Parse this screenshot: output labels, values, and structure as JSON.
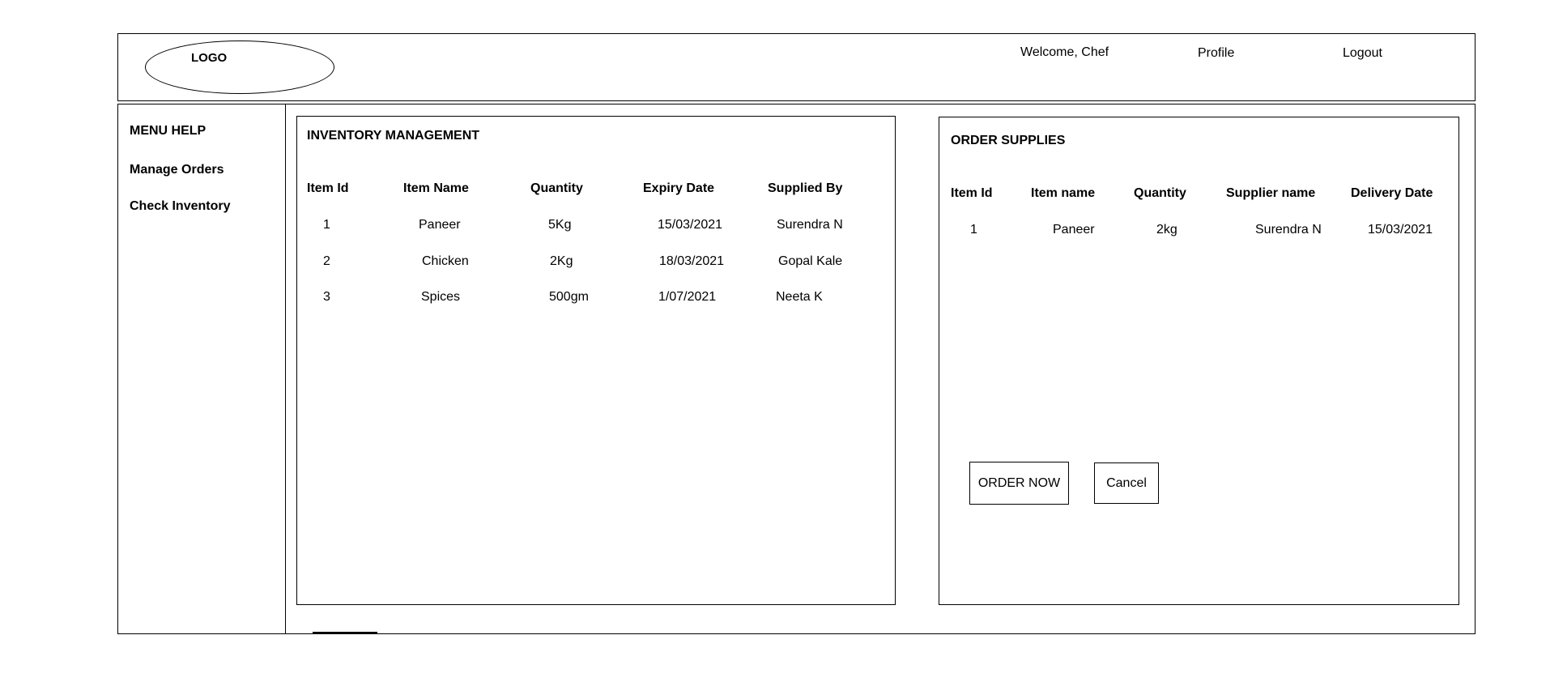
{
  "header": {
    "logo_label": "LOGO",
    "welcome": "Welcome, Chef",
    "profile": "Profile",
    "logout": "Logout"
  },
  "sidebar": {
    "items": [
      {
        "label": "MENU HELP"
      },
      {
        "label": "Manage Orders"
      },
      {
        "label": "Check Inventory"
      }
    ]
  },
  "inventory": {
    "title": "INVENTORY MANAGEMENT",
    "columns": [
      "Item Id",
      "Item Name",
      "Quantity",
      "Expiry Date",
      "Supplied By"
    ],
    "rows": [
      [
        "1",
        "Paneer",
        "5Kg",
        "15/03/2021",
        "Surendra N"
      ],
      [
        "2",
        "Chicken",
        "2Kg",
        "18/03/2021",
        "Gopal Kale"
      ],
      [
        "3",
        "Spices",
        "500gm",
        "1/07/2021",
        "Neeta K"
      ]
    ]
  },
  "order": {
    "title": "ORDER SUPPLIES",
    "columns": [
      "Item Id",
      "Item name",
      "Quantity",
      "Supplier name",
      "Delivery Date"
    ],
    "rows": [
      [
        "1",
        "Paneer",
        "2kg",
        "Surendra N",
        "15/03/2021"
      ]
    ],
    "order_button": "ORDER NOW",
    "cancel_button": "Cancel"
  }
}
